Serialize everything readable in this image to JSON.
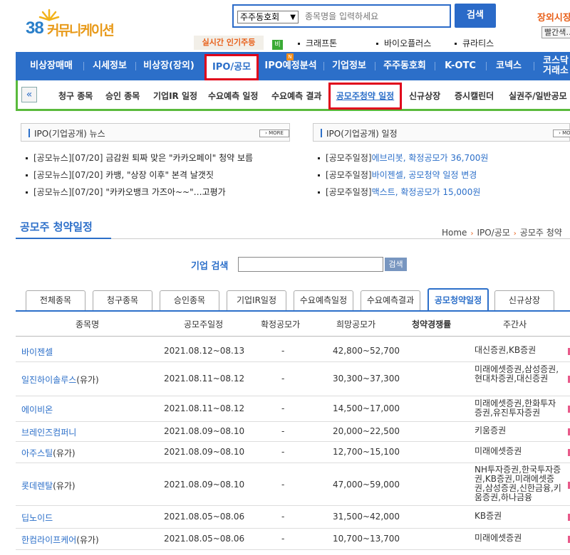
{
  "header": {
    "logo_number": "38",
    "logo_text": "커뮤니케이션",
    "search_select": "주주동호회",
    "search_placeholder": "종목명을 입력하세요",
    "search_button": "검색",
    "market_label": "장외시장",
    "market_button": "빨간색…",
    "popular_label": "실시간 인기주등",
    "popular_badge": "비",
    "popular_items": [
      "크래프톤",
      "바이오플러스",
      "큐라티스"
    ]
  },
  "nav": {
    "items": [
      "비상장매매",
      "시세정보",
      "비상장(장외)",
      "IPO/공모",
      "IPO예정분석",
      "기업정보",
      "주주동호회",
      "K-OTC",
      "코넥스",
      "코스닥"
    ],
    "last_item_line2": "거래소",
    "new_badge": "N"
  },
  "subnav": {
    "prev": "«",
    "items": [
      "청구 종목",
      "승인 종목",
      "기업IR 일정",
      "수요예측 일정",
      "수요예측 결과",
      "공모주청약 일정",
      "신규상장",
      "증시캘린더",
      "실권주/일반공모"
    ]
  },
  "news_box": {
    "title": "IPO(기업공개) 뉴스",
    "more": "› MORE",
    "items": [
      {
        "tag": "[공모뉴스][07/20]",
        "text": "금감원 퇴짜 맞은 \"카카오페이\" 청약 보름"
      },
      {
        "tag": "[공모뉴스][07/20]",
        "text": "카뱅, \"상장 이후\" 본격 날갯짓"
      },
      {
        "tag": "[공모뉴스][07/20]",
        "text": "\"카카오뱅크 가즈아~~\"…고평가"
      }
    ]
  },
  "schedule_box": {
    "title": "IPO(기업공개) 일정",
    "more": "› MORE",
    "items": [
      {
        "tag": "[공모주일정]",
        "text": "에브리봇, 확정공모가 36,700원"
      },
      {
        "tag": "[공모주일정]",
        "text": "바이젠셀, 공모청약 일정 변경"
      },
      {
        "tag": "[공모주일정]",
        "text": "맥스트, 확정공모가 15,000원"
      }
    ]
  },
  "section": {
    "title": "공모주 청약일정",
    "breadcrumb": [
      "Home",
      "IPO/공모",
      "공모주 청약"
    ]
  },
  "company_search": {
    "label": "기업 검색",
    "button": "검색"
  },
  "tabs": [
    "전체종목",
    "청구종목",
    "승인종목",
    "기업IR일정",
    "수요예측일정",
    "수요예측결과",
    "공모청약일정",
    "신규상장"
  ],
  "table": {
    "headers": [
      "종목명",
      "공모주일정",
      "확정공모가",
      "희망공모가",
      "청약경쟁률",
      "주간사"
    ],
    "rows": [
      {
        "name": "바이젠셀",
        "kind": "",
        "date": "2021.08.12~08.13",
        "confirmed": "-",
        "hope": "42,800~52,700",
        "underwriter": "대신증권,KB증권"
      },
      {
        "name": "일진하이솔루스",
        "kind": "(유가)",
        "date": "2021.08.11~08.12",
        "confirmed": "-",
        "hope": "30,300~37,300",
        "underwriter": "미래에셋증권,삼성증권,현대차증권,대신증권"
      },
      {
        "name": "에이비온",
        "kind": "",
        "date": "2021.08.11~08.12",
        "confirmed": "-",
        "hope": "14,500~17,000",
        "underwriter": "미래에셋증권,한화투자증권,유진투자증권"
      },
      {
        "name": "브레인즈컴퍼니",
        "kind": "",
        "date": "2021.08.09~08.10",
        "confirmed": "-",
        "hope": "20,000~22,500",
        "underwriter": "키움증권"
      },
      {
        "name": "아주스틸",
        "kind": "(유가)",
        "date": "2021.08.09~08.10",
        "confirmed": "-",
        "hope": "12,700~15,100",
        "underwriter": "미래에셋증권"
      },
      {
        "name": "롯데렌탈",
        "kind": "(유가)",
        "date": "2021.08.09~08.10",
        "confirmed": "-",
        "hope": "47,000~59,000",
        "underwriter": "NH투자증권,한국투자증권,KB증권,미래에셋증권,삼성증권,신한금융,키움증권,하나금융"
      },
      {
        "name": "딥노이드",
        "kind": "",
        "date": "2021.08.05~08.06",
        "confirmed": "-",
        "hope": "31,500~42,000",
        "underwriter": "KB증권"
      },
      {
        "name": "한컴라이프케어",
        "kind": "(유가)",
        "date": "2021.08.05~08.06",
        "confirmed": "-",
        "hope": "10,700~13,700",
        "underwriter": "미래에셋증권"
      }
    ]
  }
}
